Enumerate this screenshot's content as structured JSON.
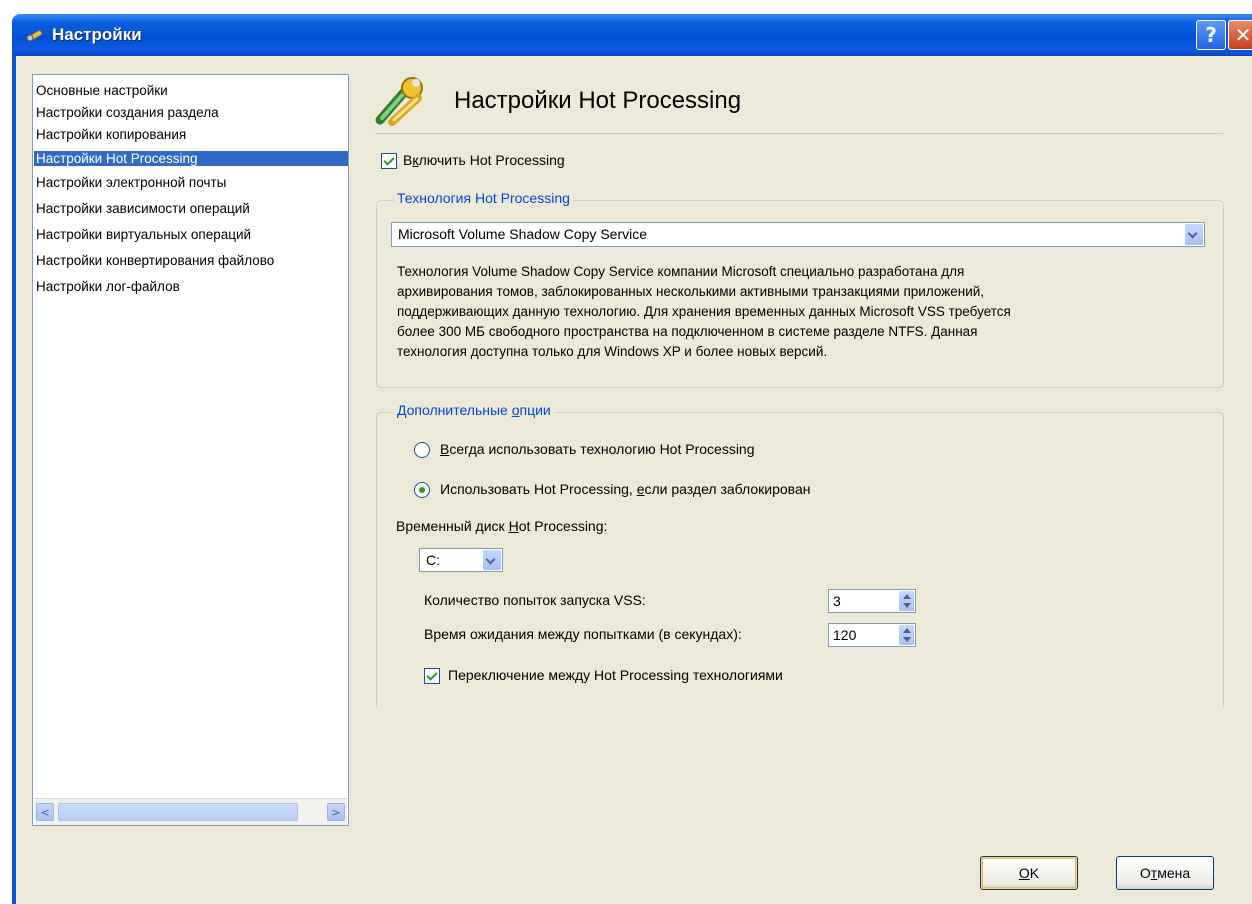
{
  "window": {
    "title": "Настройки",
    "help_glyph": "?",
    "close_glyph": "✕"
  },
  "sidebar": {
    "items": [
      {
        "label": "Основные настройки",
        "selected": false
      },
      {
        "label": "Настройки создания раздела",
        "selected": false
      },
      {
        "label": "Настройки копирования",
        "selected": false
      },
      {
        "label": "Настройки Hot Processing",
        "selected": true
      },
      {
        "label": "Настройки электронной почты",
        "selected": false
      },
      {
        "label": "Настройки зависимости операций",
        "selected": false
      },
      {
        "label": "Настройки виртуальных операций",
        "selected": false
      },
      {
        "label": "Настройки конвертирования файлово",
        "selected": false
      },
      {
        "label": "Настройки лог-файлов",
        "selected": false
      }
    ],
    "scroll_left_glyph": "<",
    "scroll_right_glyph": ">"
  },
  "header": {
    "title": "Настройки Hot Processing",
    "icon": "wrench-icon"
  },
  "enable_hot_processing": {
    "label_pre": "В",
    "label_key": "к",
    "label_post": "лючить Hot Processing",
    "checked": true
  },
  "technology_group": {
    "legend": "Технология Hot Processing",
    "selected": "Microsoft Volume Shadow Copy Service",
    "description_lines": [
      "Технология Volume Shadow Copy Service компании Microsoft специально разработана для",
      "архивирования томов, заблокированных несколькими активными транзакциями приложений,",
      "поддерживающих данную технологию. Для хранения временных данных Microsoft VSS требуется",
      "более 300 МБ свободного пространства на подключенном в системе разделе NTFS. Данная",
      "технология доступна только для Windows XP и более новых версий."
    ]
  },
  "options_group": {
    "legend_pre": "Дополнительные ",
    "legend_key": "о",
    "legend_post": "пции",
    "radio_always": {
      "pre": "",
      "key": "В",
      "post": "сегда использовать технологию Hot Processing",
      "checked": false
    },
    "radio_if_locked": {
      "pre": "Использовать Hot Processing, ",
      "key": "е",
      "post": "сли раздел заблокирован",
      "checked": true
    },
    "temp_disk_label_pre": "Временный диск ",
    "temp_disk_label_key": "H",
    "temp_disk_label_post": "ot Processing:",
    "temp_disk_value": "C:",
    "vss_attempts_label": "Количество попыток запуска VSS:",
    "vss_attempts_value": "3",
    "wait_label": "Время ожидания между попытками (в секундах):",
    "wait_value": "120",
    "switch_label": "Переключение между Hot Processing технологиями",
    "switch_checked": true
  },
  "footer": {
    "ok_key": "O",
    "ok_post": "K",
    "cancel_pre": "О",
    "cancel_key": "т",
    "cancel_post": "мена"
  }
}
